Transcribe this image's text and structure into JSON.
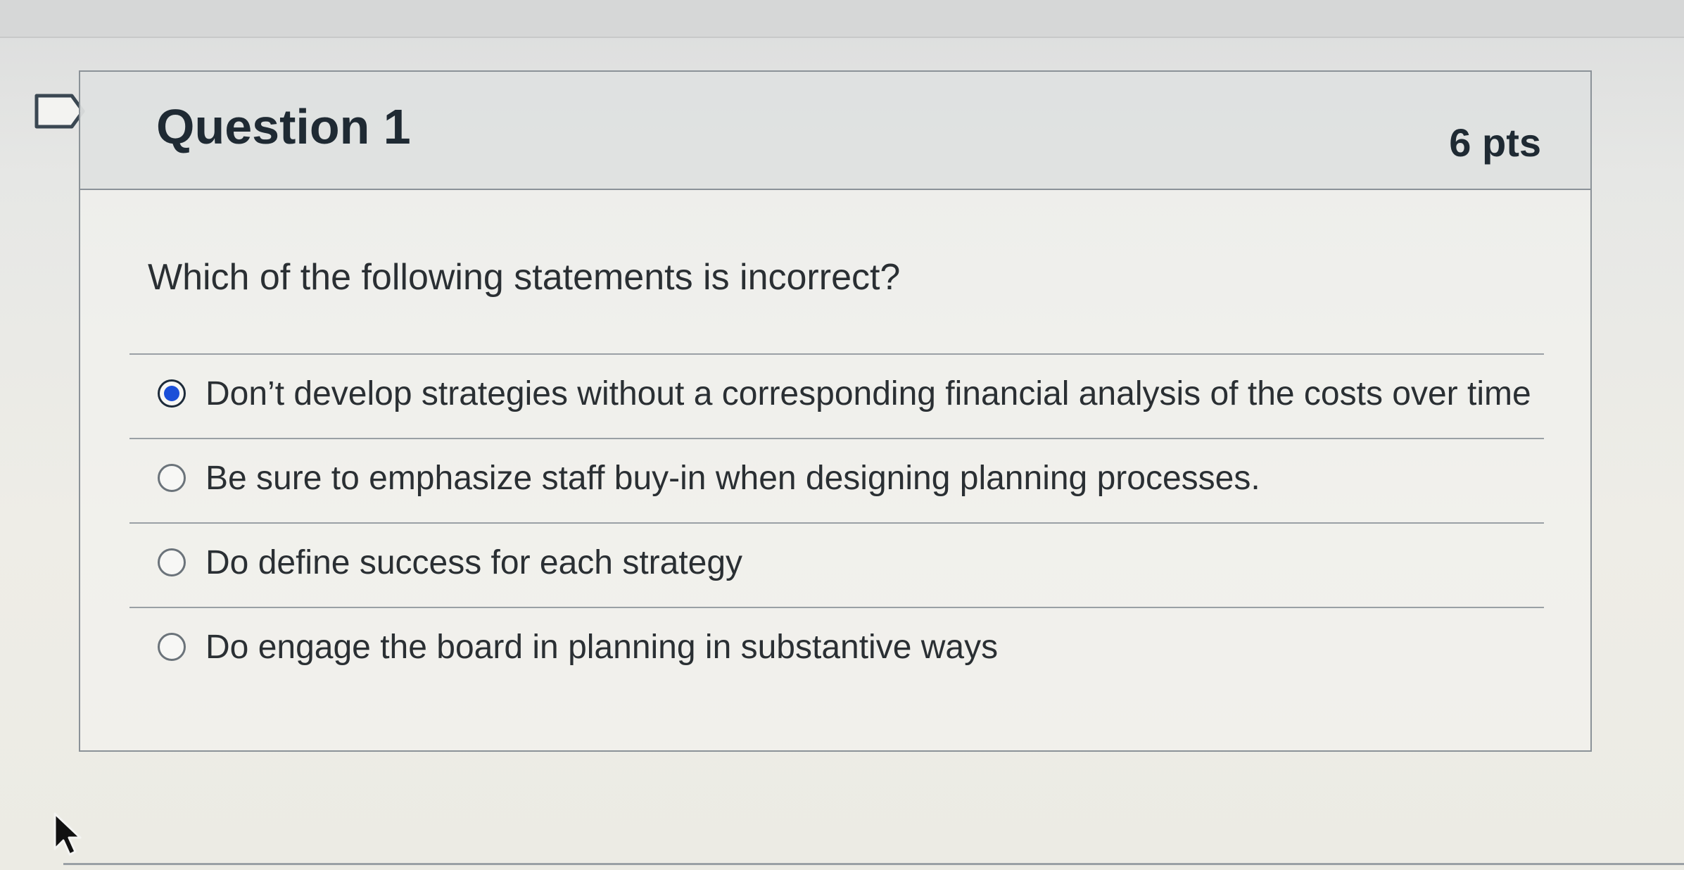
{
  "question": {
    "title": "Question 1",
    "points": "6 pts",
    "text": "Which of the following statements is incorrect?",
    "answers": [
      {
        "label": "Don’t develop strategies without a corresponding financial analysis of the costs over time",
        "selected": true
      },
      {
        "label": "Be sure to emphasize staff buy-in when designing planning processes.",
        "selected": false
      },
      {
        "label": "Do define success for each strategy",
        "selected": false
      },
      {
        "label": "Do engage the board in planning in substantive ways",
        "selected": false
      }
    ]
  },
  "icons": {
    "flag": "flag-icon",
    "cursor": "mouse-pointer-icon",
    "radio_accent": "#1b4fd8"
  }
}
